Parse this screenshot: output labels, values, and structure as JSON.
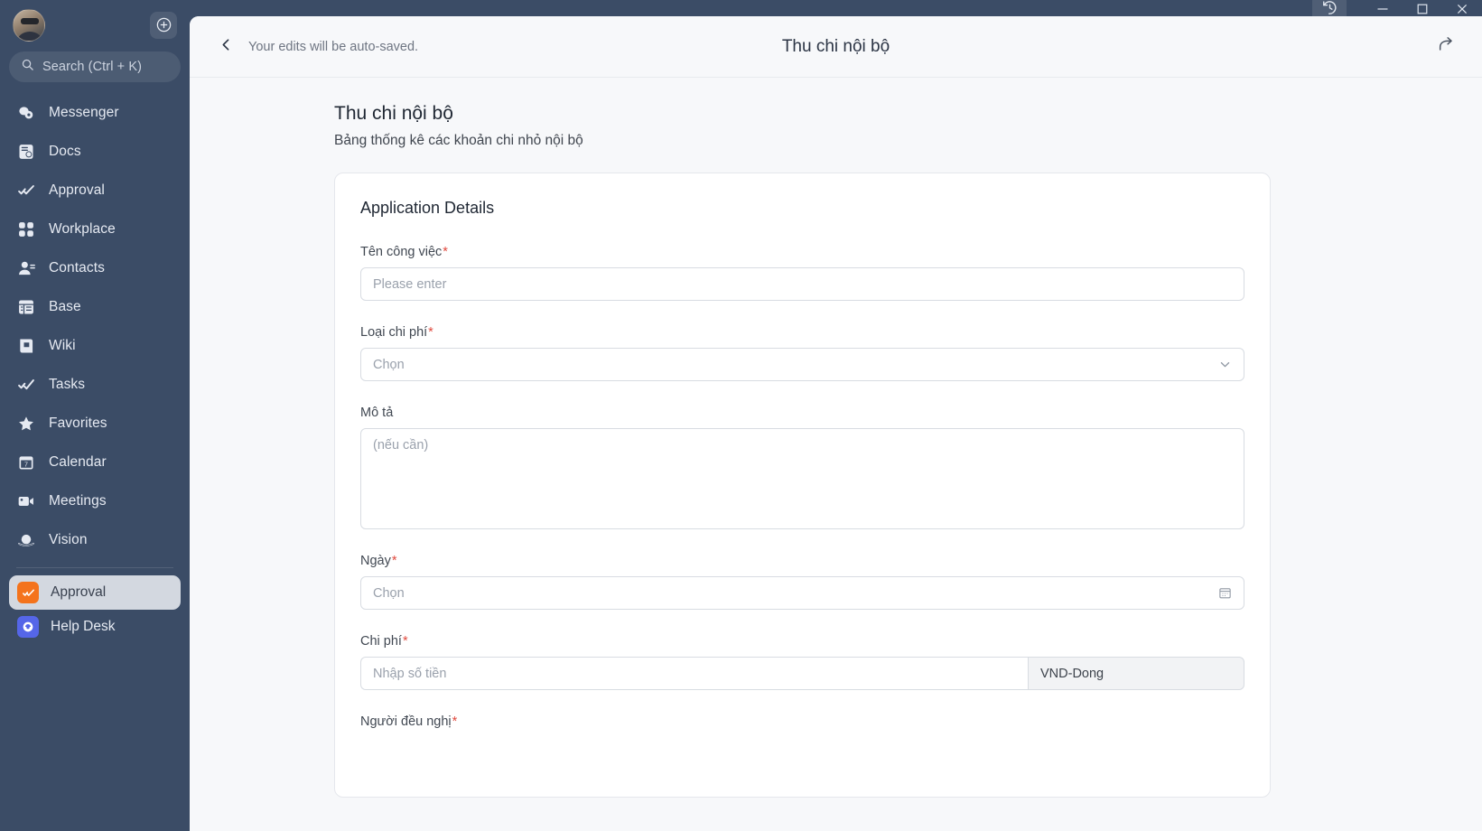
{
  "sidebar": {
    "avatar_name": "user-avatar",
    "add_button": "add-icon",
    "search": {
      "placeholder": "Search (Ctrl + K)"
    },
    "nav_items": [
      {
        "label": "Messenger",
        "icon": "messenger-icon"
      },
      {
        "label": "Docs",
        "icon": "docs-icon"
      },
      {
        "label": "Approval",
        "icon": "approval-icon"
      },
      {
        "label": "Workplace",
        "icon": "workplace-icon"
      },
      {
        "label": "Contacts",
        "icon": "contacts-icon"
      },
      {
        "label": "Base",
        "icon": "base-icon"
      },
      {
        "label": "Wiki",
        "icon": "wiki-icon"
      },
      {
        "label": "Tasks",
        "icon": "tasks-icon"
      },
      {
        "label": "Favorites",
        "icon": "star-icon"
      },
      {
        "label": "Calendar",
        "icon": "calendar-icon"
      },
      {
        "label": "Meetings",
        "icon": "video-camera-icon"
      },
      {
        "label": "Vision",
        "icon": "vision-icon"
      }
    ],
    "pinned_apps": [
      {
        "label": "Approval",
        "icon": "approval-app-icon",
        "active": true,
        "color": "#f4731c"
      },
      {
        "label": "Help Desk",
        "icon": "help-desk-icon",
        "active": false,
        "color": "#5566e8"
      }
    ]
  },
  "window": {
    "history_icon": "history-icon",
    "minimize": "minimize-icon",
    "maximize": "maximize-icon",
    "close": "close-icon"
  },
  "header": {
    "back_icon": "back-chevron-icon",
    "autosave_text": "Your edits will be auto-saved.",
    "title": "Thu chi nội bộ",
    "share_icon": "share-icon"
  },
  "document": {
    "title": "Thu chi nội bộ",
    "subtitle": "Bảng thống kê các khoản chi nhỏ nội bộ"
  },
  "form": {
    "section_title": "Application Details",
    "fields": {
      "job_name": {
        "label": "Tên công việc",
        "required": "*",
        "placeholder": "Please enter"
      },
      "expense_type": {
        "label": "Loại chi phí",
        "required": "*",
        "placeholder": "Chọn"
      },
      "description": {
        "label": "Mô tả",
        "required": "",
        "placeholder": "(nếu cần)"
      },
      "date": {
        "label": "Ngày",
        "required": "*",
        "placeholder": "Chọn"
      },
      "cost": {
        "label": "Chi phí",
        "required": "*",
        "placeholder": "Nhập số tiền",
        "currency": "VND-Dong"
      },
      "requester": {
        "label": "Người đều nghị",
        "required": "*"
      }
    }
  },
  "colors": {
    "sidebar_bg": "#3b4c66",
    "accent_orange": "#f4731c",
    "accent_blue": "#5566e8",
    "required_red": "#e04a3f",
    "panel_bg": "#f7f8fa"
  }
}
